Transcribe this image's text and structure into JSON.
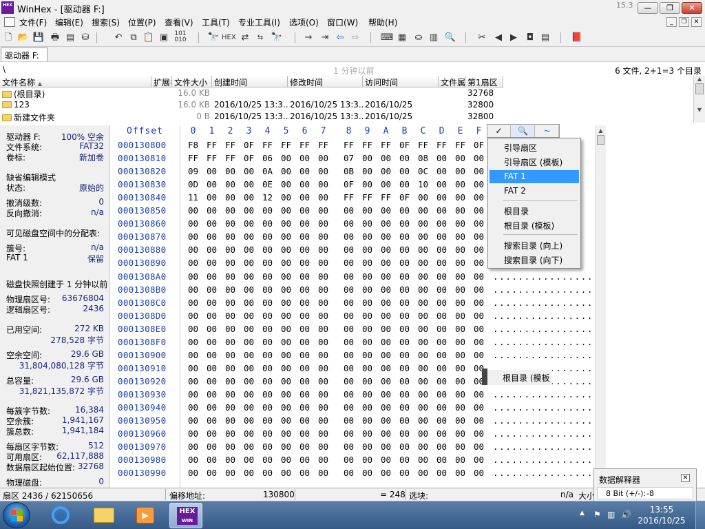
{
  "window": {
    "title": "WinHex - [驱动器 F:]",
    "version": "15.3",
    "app_icon_text": "HEX",
    "controls": {
      "minimize": "—",
      "maximize": "❐",
      "close": "✕"
    },
    "mdi_controls": {
      "minimize": "_",
      "restore": "❐",
      "close": "✕"
    }
  },
  "menu": [
    "文件(F)",
    "编辑(E)",
    "搜索(S)",
    "位置(P)",
    "查看(V)",
    "工具(T)",
    "专业工具(I)",
    "选项(O)",
    "窗口(W)",
    "帮助(H)"
  ],
  "toolbar": [
    "new-file-icon",
    "open-icon",
    "save-icon",
    "print-icon",
    "properties-icon",
    "open-disk-icon",
    "undo-icon",
    "copy-icon",
    "paste-icon",
    "clipboard-icon",
    "binary-icon",
    "find-icon",
    "find-hex-icon",
    "replace-icon",
    "replace-hex-icon",
    "find-next-icon",
    "goto-offset-icon",
    "goto-sector-icon",
    "back-icon",
    "forward-icon",
    "disk-editor-icon",
    "ram-editor-icon",
    "disk-icon",
    "calculator-icon",
    "zoom-icon",
    "tools-icon",
    "prev-icon",
    "next-icon",
    "snapshot-icon",
    "sector-view-icon",
    "help-book-icon"
  ],
  "tab": {
    "label": "驱动器 F:"
  },
  "path": {
    "current": "\\",
    "snapshot": "1 分钟以前",
    "summary": "6 文件, 2+1=3 个目录"
  },
  "dirlist": {
    "columns": [
      "文件名称",
      "扩展名",
      "文件大小",
      "创建时间",
      "修改时间",
      "访问时间",
      "文件属性",
      "第1扇区"
    ],
    "rows": [
      {
        "name": "(根目录)",
        "ext": "",
        "size": "16.0 KB",
        "created": "",
        "modified": "",
        "accessed": "",
        "attr": "",
        "sector": "32768"
      },
      {
        "name": "123",
        "ext": "",
        "size": "16.0 KB",
        "created": "2016/10/25 13:3...",
        "modified": "2016/10/25 13:3...",
        "accessed": "2016/10/25",
        "attr": "",
        "sector": "32800"
      },
      {
        "name": "新建文件夹",
        "ext": "",
        "size": "0 B",
        "created": "2016/10/25 13:3...",
        "modified": "2016/10/25 13:3...",
        "accessed": "2016/10/25",
        "attr": "",
        "sector": "32800"
      }
    ]
  },
  "info": [
    {
      "label": "驱动器 F:",
      "value": "100% 空余"
    },
    {
      "label": "文件系统:",
      "value": "FAT32"
    },
    {
      "label": "卷标:",
      "value": "新加卷"
    },
    {
      "label": "缺省编辑模式",
      "value": ""
    },
    {
      "label": "状态:",
      "value": "原始的"
    },
    {
      "label": "撤消级数:",
      "value": "0"
    },
    {
      "label": "反向撤消:",
      "value": "n/a"
    },
    {
      "label": "可见磁盘空间中的分配表:",
      "value": ""
    },
    {
      "label": "簇号:",
      "value": "n/a"
    },
    {
      "label": "FAT 1",
      "value": "保留"
    },
    {
      "label": "磁盘快照创建于 1 分钟以前",
      "value": ""
    },
    {
      "label": "物理扇区号:",
      "value": "63676804"
    },
    {
      "label": "逻辑扇区号:",
      "value": "2436"
    },
    {
      "label": "已用空间:",
      "value": "272 KB"
    },
    {
      "label": "",
      "value": "278,528 字节"
    },
    {
      "label": "空余空间:",
      "value": "29.6 GB"
    },
    {
      "label": "",
      "value": "31,804,080,128 字节"
    },
    {
      "label": "总容量:",
      "value": "29.6 GB"
    },
    {
      "label": "",
      "value": "31,821,135,872 字节"
    },
    {
      "label": "每簇字节数:",
      "value": "16,384"
    },
    {
      "label": "空余簇:",
      "value": "1,941,167"
    },
    {
      "label": "簇总数:",
      "value": "1,941,184"
    },
    {
      "label": "每扇区字节数:",
      "value": "512"
    },
    {
      "label": "可用扇区:",
      "value": "62,117,888"
    },
    {
      "label": "数据扇区起始位置:",
      "value": "32768"
    },
    {
      "label": "物理磁盘:",
      "value": "0"
    }
  ],
  "hex": {
    "offset_label": "Offset",
    "columns": [
      "0",
      "1",
      "2",
      "3",
      "4",
      "5",
      "6",
      "7",
      "8",
      "9",
      "A",
      "B",
      "C",
      "D",
      "E",
      "F"
    ],
    "rows": [
      {
        "offset": "000130800",
        "bytes": [
          "F8",
          "FF",
          "FF",
          "0F",
          "FF",
          "FF",
          "FF",
          "FF",
          "FF",
          "FF",
          "FF",
          "0F",
          "FF",
          "FF",
          "FF",
          "0F"
        ],
        "ascii": ""
      },
      {
        "offset": "000130810",
        "bytes": [
          "FF",
          "FF",
          "FF",
          "0F",
          "06",
          "00",
          "00",
          "00",
          "07",
          "00",
          "00",
          "00",
          "08",
          "00",
          "00",
          "00"
        ],
        "ascii": ""
      },
      {
        "offset": "000130820",
        "bytes": [
          "09",
          "00",
          "00",
          "00",
          "0A",
          "00",
          "00",
          "00",
          "0B",
          "00",
          "00",
          "00",
          "0C",
          "00",
          "00",
          "00"
        ],
        "ascii": ""
      },
      {
        "offset": "000130830",
        "bytes": [
          "0D",
          "00",
          "00",
          "00",
          "0E",
          "00",
          "00",
          "00",
          "0F",
          "00",
          "00",
          "00",
          "10",
          "00",
          "00",
          "00"
        ],
        "ascii": ""
      },
      {
        "offset": "000130840",
        "bytes": [
          "11",
          "00",
          "00",
          "00",
          "12",
          "00",
          "00",
          "00",
          "FF",
          "FF",
          "FF",
          "0F",
          "00",
          "00",
          "00",
          "00"
        ],
        "ascii": ""
      },
      {
        "offset": "000130850",
        "bytes": [
          "00",
          "00",
          "00",
          "00",
          "00",
          "00",
          "00",
          "00",
          "00",
          "00",
          "00",
          "00",
          "00",
          "00",
          "00",
          "00"
        ],
        "ascii": ""
      },
      {
        "offset": "000130860",
        "bytes": [
          "00",
          "00",
          "00",
          "00",
          "00",
          "00",
          "00",
          "00",
          "00",
          "00",
          "00",
          "00",
          "00",
          "00",
          "00",
          "00"
        ],
        "ascii": ""
      },
      {
        "offset": "000130870",
        "bytes": [
          "00",
          "00",
          "00",
          "00",
          "00",
          "00",
          "00",
          "00",
          "00",
          "00",
          "00",
          "00",
          "00",
          "00",
          "00",
          "00"
        ],
        "ascii": ""
      },
      {
        "offset": "000130880",
        "bytes": [
          "00",
          "00",
          "00",
          "00",
          "00",
          "00",
          "00",
          "00",
          "00",
          "00",
          "00",
          "00",
          "00",
          "00",
          "00",
          "00"
        ],
        "ascii": ""
      },
      {
        "offset": "000130890",
        "bytes": [
          "00",
          "00",
          "00",
          "00",
          "00",
          "00",
          "00",
          "00",
          "00",
          "00",
          "00",
          "00",
          "00",
          "00",
          "00",
          "00"
        ],
        "ascii": ""
      },
      {
        "offset": "0001308A0",
        "bytes": [
          "00",
          "00",
          "00",
          "00",
          "00",
          "00",
          "00",
          "00",
          "00",
          "00",
          "00",
          "00",
          "00",
          "00",
          "00",
          "00"
        ],
        "ascii": "................"
      },
      {
        "offset": "0001308B0",
        "bytes": [
          "00",
          "00",
          "00",
          "00",
          "00",
          "00",
          "00",
          "00",
          "00",
          "00",
          "00",
          "00",
          "00",
          "00",
          "00",
          "00"
        ],
        "ascii": "................"
      },
      {
        "offset": "0001308C0",
        "bytes": [
          "00",
          "00",
          "00",
          "00",
          "00",
          "00",
          "00",
          "00",
          "00",
          "00",
          "00",
          "00",
          "00",
          "00",
          "00",
          "00"
        ],
        "ascii": "................"
      },
      {
        "offset": "0001308D0",
        "bytes": [
          "00",
          "00",
          "00",
          "00",
          "00",
          "00",
          "00",
          "00",
          "00",
          "00",
          "00",
          "00",
          "00",
          "00",
          "00",
          "00"
        ],
        "ascii": "................"
      },
      {
        "offset": "0001308E0",
        "bytes": [
          "00",
          "00",
          "00",
          "00",
          "00",
          "00",
          "00",
          "00",
          "00",
          "00",
          "00",
          "00",
          "00",
          "00",
          "00",
          "00"
        ],
        "ascii": "................"
      },
      {
        "offset": "0001308F0",
        "bytes": [
          "00",
          "00",
          "00",
          "00",
          "00",
          "00",
          "00",
          "00",
          "00",
          "00",
          "00",
          "00",
          "00",
          "00",
          "00",
          "00"
        ],
        "ascii": "................"
      },
      {
        "offset": "000130900",
        "bytes": [
          "00",
          "00",
          "00",
          "00",
          "00",
          "00",
          "00",
          "00",
          "00",
          "00",
          "00",
          "00",
          "00",
          "00",
          "00",
          "00"
        ],
        "ascii": "................"
      },
      {
        "offset": "000130910",
        "bytes": [
          "00",
          "00",
          "00",
          "00",
          "00",
          "00",
          "00",
          "00",
          "00",
          "00",
          "00",
          "00",
          "00",
          "00",
          "00",
          "00"
        ],
        "ascii": "................"
      },
      {
        "offset": "000130920",
        "bytes": [
          "00",
          "00",
          "00",
          "00",
          "00",
          "00",
          "00",
          "00",
          "00",
          "00",
          "00",
          "00",
          "00",
          "00",
          "00",
          "00"
        ],
        "ascii": "................"
      },
      {
        "offset": "000130930",
        "bytes": [
          "00",
          "00",
          "00",
          "00",
          "00",
          "00",
          "00",
          "00",
          "00",
          "00",
          "00",
          "00",
          "00",
          "00",
          "00",
          "00"
        ],
        "ascii": "................"
      },
      {
        "offset": "000130940",
        "bytes": [
          "00",
          "00",
          "00",
          "00",
          "00",
          "00",
          "00",
          "00",
          "00",
          "00",
          "00",
          "00",
          "00",
          "00",
          "00",
          "00"
        ],
        "ascii": "................"
      },
      {
        "offset": "000130950",
        "bytes": [
          "00",
          "00",
          "00",
          "00",
          "00",
          "00",
          "00",
          "00",
          "00",
          "00",
          "00",
          "00",
          "00",
          "00",
          "00",
          "00"
        ],
        "ascii": "................"
      },
      {
        "offset": "000130960",
        "bytes": [
          "00",
          "00",
          "00",
          "00",
          "00",
          "00",
          "00",
          "00",
          "00",
          "00",
          "00",
          "00",
          "00",
          "00",
          "00",
          "00"
        ],
        "ascii": "................"
      },
      {
        "offset": "000130970",
        "bytes": [
          "00",
          "00",
          "00",
          "00",
          "00",
          "00",
          "00",
          "00",
          "00",
          "00",
          "00",
          "00",
          "00",
          "00",
          "00",
          "00"
        ],
        "ascii": "................"
      },
      {
        "offset": "000130980",
        "bytes": [
          "00",
          "00",
          "00",
          "00",
          "00",
          "00",
          "00",
          "00",
          "00",
          "00",
          "00",
          "00",
          "00",
          "00",
          "00",
          "00"
        ],
        "ascii": "................"
      },
      {
        "offset": "000130990",
        "bytes": [
          "00",
          "00",
          "00",
          "00",
          "00",
          "00",
          "00",
          "00",
          "00",
          "00",
          "00",
          "00",
          "00",
          "00",
          "00",
          "00"
        ],
        "ascii": "................"
      }
    ]
  },
  "popup": {
    "header_buttons": [
      "✓",
      "🔍",
      "~"
    ],
    "items": [
      "引导扇区",
      "引导扇区 (模板)",
      "FAT 1",
      "FAT 2",
      "根目录",
      "根目录 (模板)",
      "搜索目录 (向上)",
      "搜索目录 (向下)"
    ],
    "selected": "FAT 1",
    "ghost_item": "根目录 (模板"
  },
  "status": {
    "sector": "扇区 2436 / 62150656",
    "offset_label": "偏移地址:",
    "offset_value": "130800",
    "value": "= 248",
    "selection_label": "选块:",
    "na": "n/a",
    "size_label": "大小"
  },
  "data_interpreter": {
    "title": "数据解释器",
    "row1_label": "8 Bit (+/-):",
    "row1_value": "-8"
  },
  "taskbar": {
    "clock_time": "13:55",
    "clock_date": "2016/10/25"
  },
  "colors": {
    "accent": "#3399ff",
    "offset_blue": "#1a3fb0",
    "value_blue": "#1a237e"
  }
}
